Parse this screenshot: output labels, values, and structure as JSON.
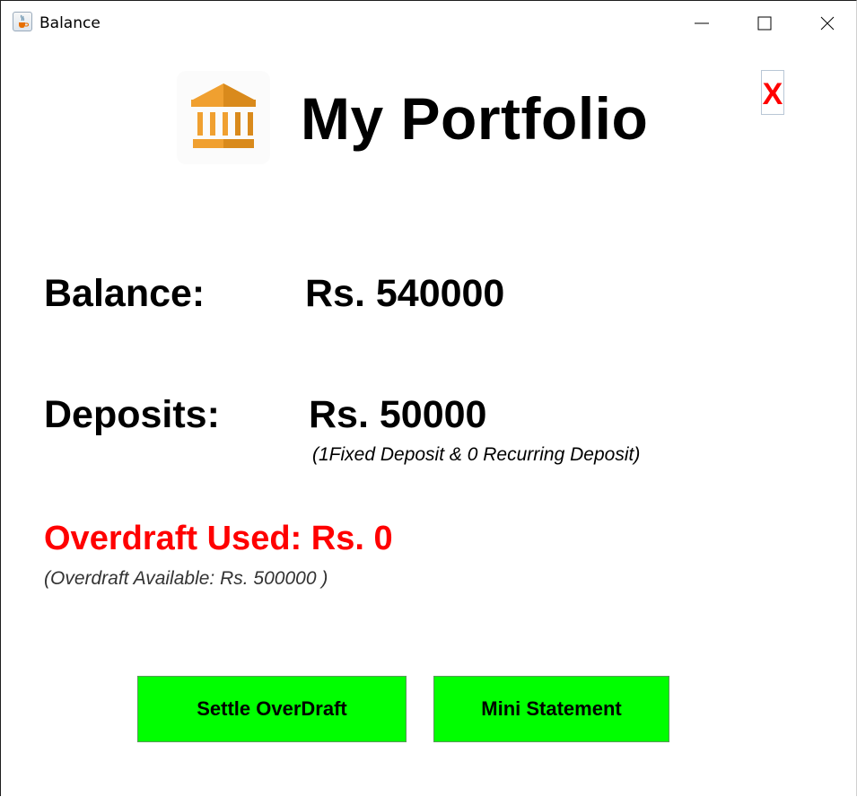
{
  "window": {
    "title": "Balance",
    "icon": "java-cup-icon",
    "controls": [
      "minimize-icon",
      "maximize-icon",
      "close-icon"
    ]
  },
  "header": {
    "icon": "bank-icon",
    "title": "My Portfolio",
    "close_label": "X"
  },
  "balance": {
    "label": "Balance:",
    "value": "Rs. 540000"
  },
  "deposits": {
    "label": "Deposits:",
    "value": "Rs. 50000",
    "note": "(1Fixed Deposit & 0 Recurring Deposit)"
  },
  "overdraft": {
    "used": "Overdraft Used: Rs. 0",
    "available": "(Overdraft Available: Rs. 500000 )"
  },
  "actions": {
    "settle_label": "Settle OverDraft",
    "mini_statement_label": "Mini Statement"
  },
  "colors": {
    "button_green": "#00ff00",
    "overdraft_red": "#ff0000",
    "bank_icon_orange": "#f0a030"
  }
}
